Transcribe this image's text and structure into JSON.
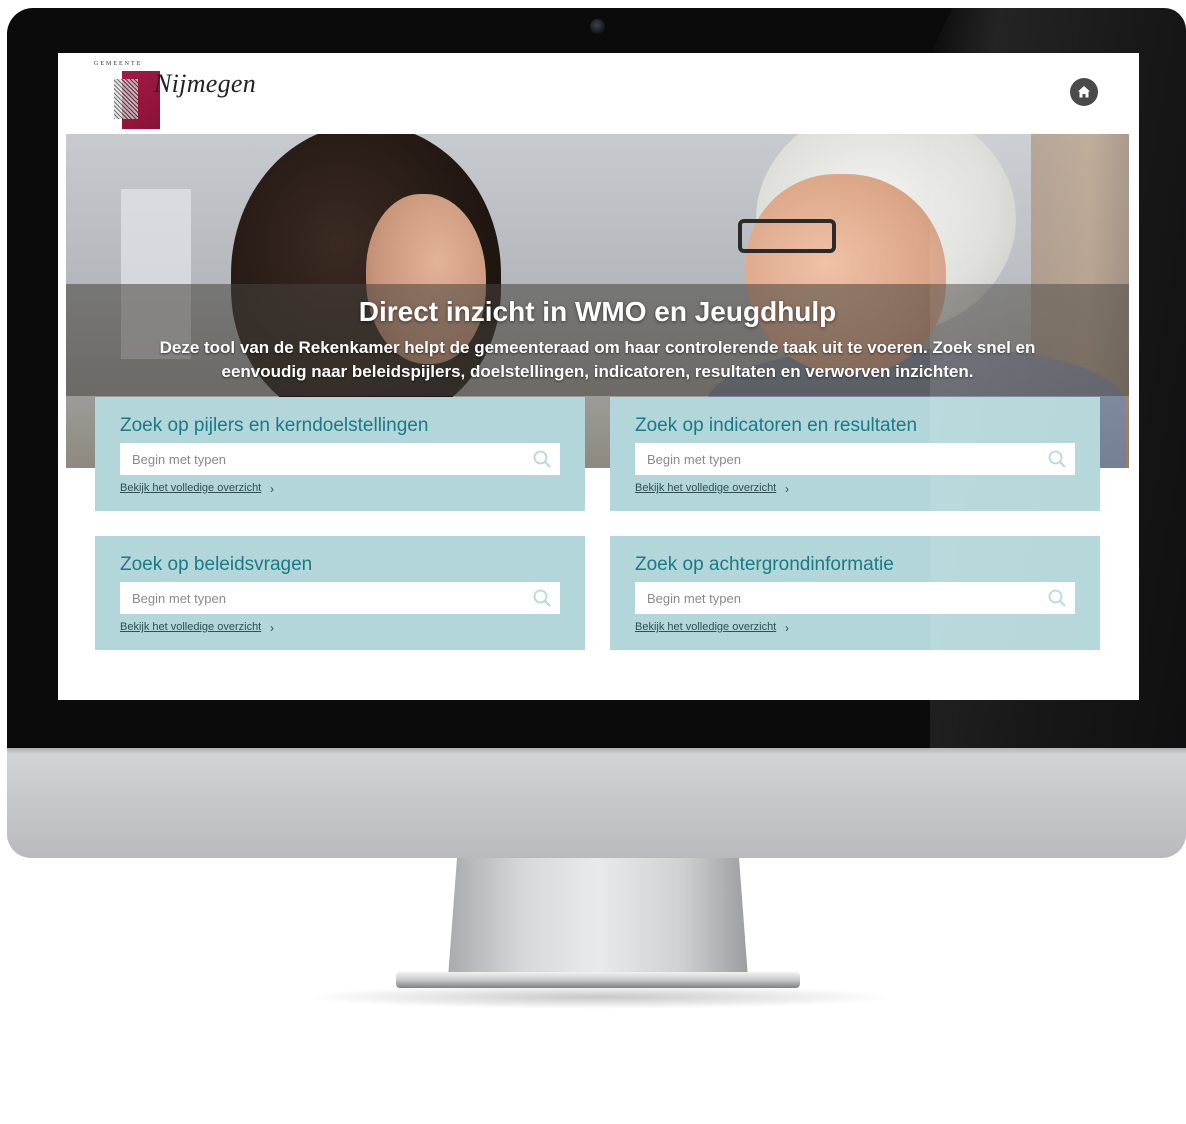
{
  "logo": {
    "small_text": "GEMEENTE",
    "name": "Nijmegen",
    "emblem": "city-emblem"
  },
  "header": {
    "home_icon": "home-icon"
  },
  "hero": {
    "title": "Direct inzicht in WMO en Jeugdhulp",
    "subtitle": "Deze tool van de Rekenkamer helpt de gemeenteraad om haar controlerende taak uit te voeren. Zoek snel en eenvoudig naar beleidspijlers, doelstellingen, indicatoren, resultaten en verworven inzichten."
  },
  "cards": [
    {
      "title": "Zoek op pijlers en kerndoelstellingen",
      "placeholder": "Begin met typen",
      "link": "Bekijk het volledige overzicht",
      "chevron": "›"
    },
    {
      "title": "Zoek op indicatoren en resultaten",
      "placeholder": "Begin met typen",
      "link": "Bekijk het volledige overzicht",
      "chevron": "›"
    },
    {
      "title": "Zoek op beleidsvragen",
      "placeholder": "Begin met typen",
      "link": "Bekijk het volledige overzicht",
      "chevron": "›"
    },
    {
      "title": "Zoek op achtergrondinformatie",
      "placeholder": "Begin met typen",
      "link": "Bekijk het volledige overzicht",
      "chevron": "›"
    }
  ],
  "colors": {
    "card_bg": "#b2d6d9",
    "card_title": "#1a7a86",
    "brand": "#a31a45"
  }
}
